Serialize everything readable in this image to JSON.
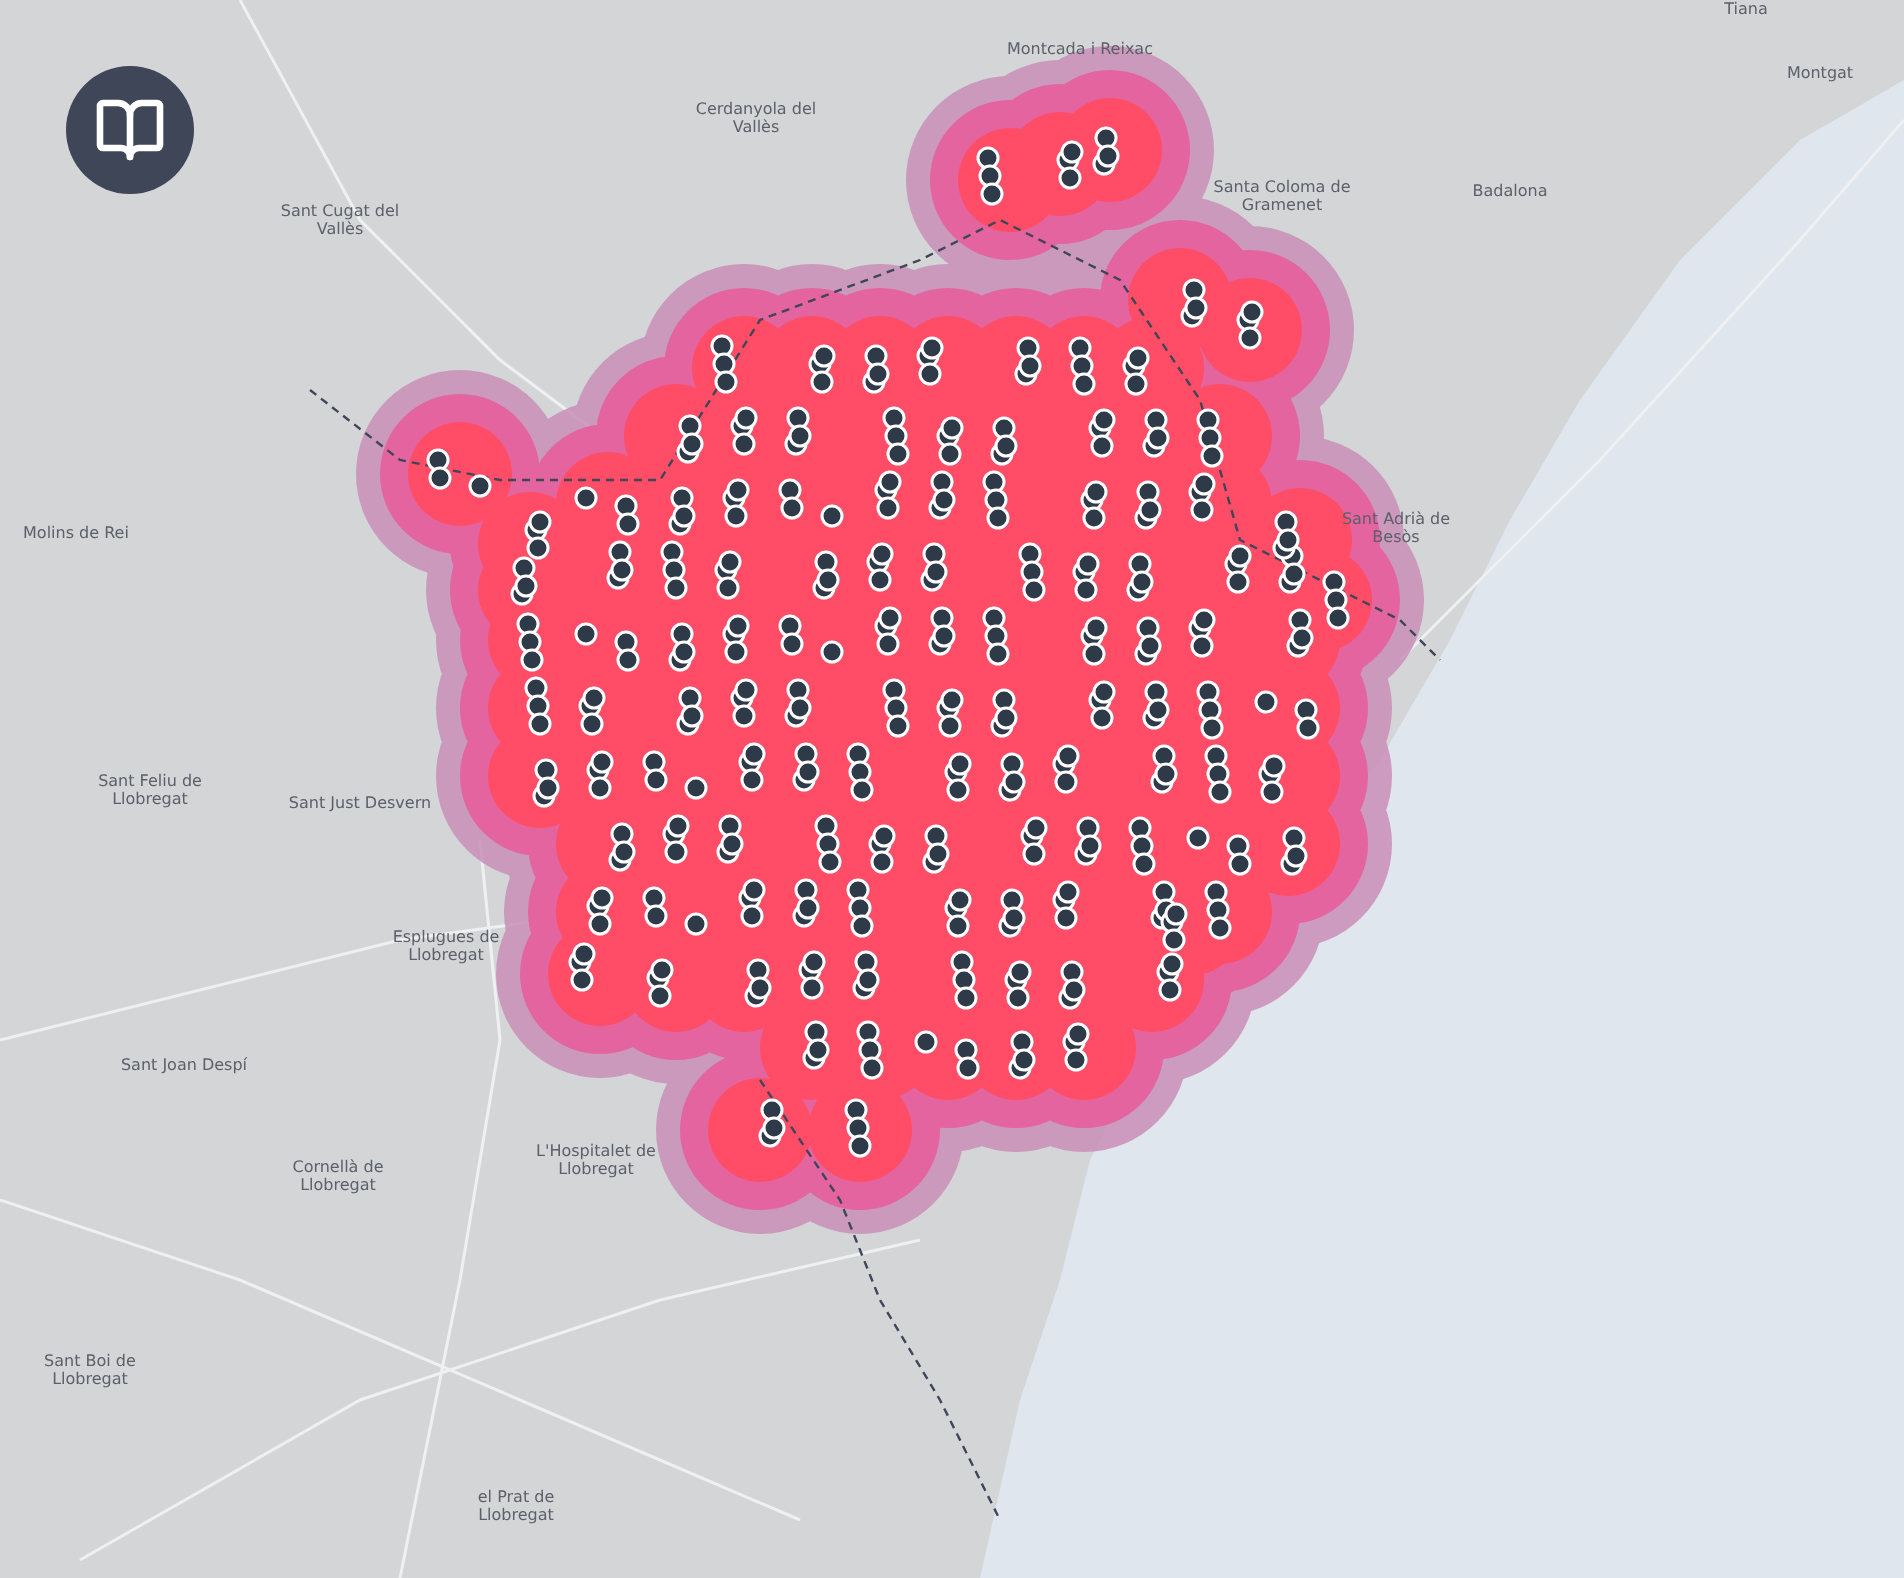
{
  "map": {
    "place_labels": [
      {
        "text": "Tiana"
      },
      {
        "text": "Montcada i Reixac"
      },
      {
        "text": "Montgat"
      },
      {
        "text": "Cerdanyola del Vallès"
      },
      {
        "text": "Sant Cugat del Vallès"
      },
      {
        "text": "Santa Coloma de Gramenet"
      },
      {
        "text": "Badalona"
      },
      {
        "text": "Molins de Rei"
      },
      {
        "text": "Sant Adrià de Besòs"
      },
      {
        "text": "Sant Feliu de Llobregat"
      },
      {
        "text": "Sant Just Desvern"
      },
      {
        "text": "Esplugues de Llobregat"
      },
      {
        "text": "Sant Joan Despí"
      },
      {
        "text": "Cornellà de Llobregat"
      },
      {
        "text": "L'Hospitalet de Llobregat"
      },
      {
        "text": "Sant Boi de Llobregat"
      },
      {
        "text": "el Prat de Llobregat"
      }
    ]
  }
}
